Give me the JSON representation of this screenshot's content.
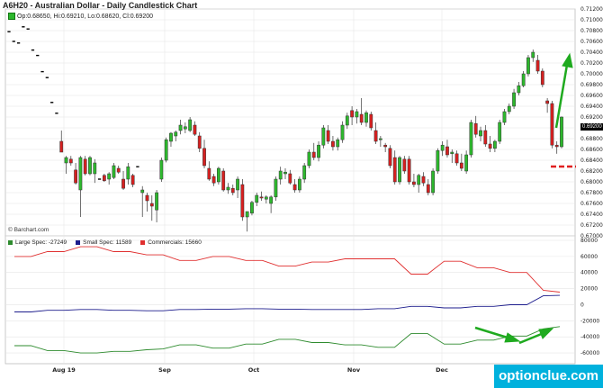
{
  "header": {
    "title": "A6H20 - Australian Dollar - Daily Candlestick Chart",
    "ohlc": "Op:0.68650, Hi:0.69210, Lo:0.68620, Cl:0.69200"
  },
  "credit": "© Barchart.com",
  "watermark": "optionclue.com",
  "last_price_label": "0.69200",
  "colors": {
    "up": "#2db82d",
    "down": "#d62020",
    "large_spec": "#2e8b2e",
    "small_spec": "#1c1c8c",
    "commercials": "#e03030",
    "arrow": "#1faa1f"
  },
  "chart_data": [
    {
      "type": "candlestick",
      "ylim": [
        0.67,
        0.712
      ],
      "yticks": [
        "0.71200",
        "0.71000",
        "0.70800",
        "0.70600",
        "0.70400",
        "0.70200",
        "0.70000",
        "0.69800",
        "0.69600",
        "0.69400",
        "0.69200",
        "0.69000",
        "0.68800",
        "0.68600",
        "0.68400",
        "0.68200",
        "0.68000",
        "0.67800",
        "0.67600",
        "0.67400",
        "0.67200",
        "0.67000"
      ],
      "xticks": [
        "Aug 19",
        "Sep",
        "Oct",
        "Nov",
        "Dec"
      ],
      "last_price": 0.692,
      "candles": [
        [
          0.7075,
          0.708,
          0.7072,
          0.7078
        ],
        [
          0.7062,
          0.7065,
          0.7058,
          0.706
        ],
        [
          0.7058,
          0.706,
          0.7055,
          0.7057
        ],
        [
          0.7086,
          0.7089,
          0.7084,
          0.7087
        ],
        [
          0.7082,
          0.7085,
          0.708,
          0.7083
        ],
        [
          0.7045,
          0.7048,
          0.7042,
          0.7044
        ],
        [
          0.7035,
          0.7038,
          0.7032,
          0.7034
        ],
        [
          0.7005,
          0.7008,
          0.7002,
          0.7004
        ],
        [
          0.6992,
          0.6995,
          0.699,
          0.6993
        ],
        [
          0.6948,
          0.695,
          0.6945,
          0.6947
        ],
        [
          0.6928,
          0.693,
          0.6926,
          0.6927
        ],
        [
          0.6875,
          0.6895,
          0.6855,
          0.6855
        ],
        [
          0.6835,
          0.6848,
          0.6815,
          0.6845
        ],
        [
          0.6842,
          0.6848,
          0.683,
          0.6835
        ],
        [
          0.6822,
          0.6835,
          0.6795,
          0.6798
        ],
        [
          0.6785,
          0.6848,
          0.6735,
          0.6845
        ],
        [
          0.6842,
          0.6848,
          0.6812,
          0.6815
        ],
        [
          0.6815,
          0.6848,
          0.6812,
          0.6845
        ],
        [
          0.6815,
          0.6842,
          0.6798,
          0.6835
        ],
        [
          0.6802,
          0.6808,
          0.68,
          0.6805
        ],
        [
          0.6812,
          0.6815,
          0.68,
          0.6802
        ],
        [
          0.6805,
          0.6818,
          0.6795,
          0.6815
        ],
        [
          0.6808,
          0.6835,
          0.6805,
          0.683
        ],
        [
          0.6825,
          0.683,
          0.6815,
          0.6818
        ],
        [
          0.6805,
          0.682,
          0.6785,
          0.6788
        ],
        [
          0.6805,
          0.6835,
          0.6795,
          0.6828
        ],
        [
          0.6812,
          0.6815,
          0.679,
          0.6795
        ],
        [
          0.683,
          0.6832,
          0.6825,
          0.6828
        ],
        [
          0.678,
          0.6792,
          0.6735,
          0.6785
        ],
        [
          0.6775,
          0.678,
          0.6745,
          0.6765
        ],
        [
          0.676,
          0.6775,
          0.6728,
          0.6755
        ],
        [
          0.6748,
          0.6785,
          0.6725,
          0.678
        ],
        [
          0.6805,
          0.6845,
          0.68,
          0.684
        ],
        [
          0.684,
          0.6882,
          0.6836,
          0.6878
        ],
        [
          0.6875,
          0.6892,
          0.6865,
          0.689
        ],
        [
          0.6885,
          0.6895,
          0.6875,
          0.6892
        ],
        [
          0.6895,
          0.6915,
          0.6888,
          0.6905
        ],
        [
          0.6898,
          0.691,
          0.689,
          0.6902
        ],
        [
          0.6895,
          0.692,
          0.6892,
          0.6915
        ],
        [
          0.6905,
          0.6912,
          0.6885,
          0.6888
        ],
        [
          0.6885,
          0.6892,
          0.6855,
          0.6862
        ],
        [
          0.6862,
          0.6878,
          0.6825,
          0.683
        ],
        [
          0.6825,
          0.6838,
          0.6802,
          0.6805
        ],
        [
          0.681,
          0.6815,
          0.6792,
          0.6798
        ],
        [
          0.68,
          0.6828,
          0.6795,
          0.6825
        ],
        [
          0.682,
          0.6825,
          0.6782,
          0.6785
        ],
        [
          0.6785,
          0.6798,
          0.6778,
          0.679
        ],
        [
          0.6788,
          0.6795,
          0.6775,
          0.678
        ],
        [
          0.6785,
          0.681,
          0.677,
          0.6805
        ],
        [
          0.6795,
          0.6805,
          0.6728,
          0.6735
        ],
        [
          0.6735,
          0.6745,
          0.6708,
          0.6745
        ],
        [
          0.6742,
          0.6765,
          0.6738,
          0.6762
        ],
        [
          0.6762,
          0.678,
          0.6755,
          0.6775
        ],
        [
          0.6772,
          0.6782,
          0.6765,
          0.677
        ],
        [
          0.6768,
          0.6775,
          0.676,
          0.6772
        ],
        [
          0.676,
          0.6775,
          0.6742,
          0.6772
        ],
        [
          0.6772,
          0.681,
          0.6765,
          0.6805
        ],
        [
          0.6805,
          0.6828,
          0.6795,
          0.682
        ],
        [
          0.6815,
          0.6825,
          0.6805,
          0.6818
        ],
        [
          0.6815,
          0.6822,
          0.6795,
          0.6798
        ],
        [
          0.6795,
          0.6805,
          0.678,
          0.6785
        ],
        [
          0.6785,
          0.681,
          0.678,
          0.6805
        ],
        [
          0.6805,
          0.6835,
          0.6798,
          0.683
        ],
        [
          0.683,
          0.686,
          0.6825,
          0.6855
        ],
        [
          0.6855,
          0.6872,
          0.684,
          0.6845
        ],
        [
          0.6845,
          0.6875,
          0.6838,
          0.6868
        ],
        [
          0.6868,
          0.6905,
          0.6862,
          0.69
        ],
        [
          0.6895,
          0.6905,
          0.687,
          0.6875
        ],
        [
          0.6875,
          0.6885,
          0.6858,
          0.6865
        ],
        [
          0.6865,
          0.6882,
          0.6858,
          0.6878
        ],
        [
          0.6878,
          0.6912,
          0.6872,
          0.6905
        ],
        [
          0.6905,
          0.6928,
          0.6898,
          0.6922
        ],
        [
          0.6932,
          0.694,
          0.6905,
          0.692
        ],
        [
          0.692,
          0.6935,
          0.6908,
          0.693
        ],
        [
          0.6925,
          0.6955,
          0.6905,
          0.691
        ],
        [
          0.691,
          0.6932,
          0.6902,
          0.6928
        ],
        [
          0.6925,
          0.693,
          0.6895,
          0.69
        ],
        [
          0.6895,
          0.691,
          0.687,
          0.6875
        ],
        [
          0.6878,
          0.6885,
          0.6865,
          0.688
        ],
        [
          0.6868,
          0.6872,
          0.6855,
          0.6865
        ],
        [
          0.6862,
          0.6868,
          0.6825,
          0.683
        ],
        [
          0.6845,
          0.6858,
          0.6795,
          0.68
        ],
        [
          0.68,
          0.6848,
          0.6795,
          0.6845
        ],
        [
          0.6842,
          0.6848,
          0.6815,
          0.682
        ],
        [
          0.6842,
          0.6848,
          0.6795,
          0.68
        ],
        [
          0.68,
          0.6815,
          0.679,
          0.6795
        ],
        [
          0.6795,
          0.6815,
          0.678,
          0.6812
        ],
        [
          0.681,
          0.6818,
          0.6792,
          0.6798
        ],
        [
          0.6795,
          0.6805,
          0.6775,
          0.678
        ],
        [
          0.678,
          0.6825,
          0.6775,
          0.682
        ],
        [
          0.682,
          0.6862,
          0.6815,
          0.6858
        ],
        [
          0.6858,
          0.6875,
          0.6848,
          0.6868
        ],
        [
          0.6865,
          0.6878,
          0.6845,
          0.685
        ],
        [
          0.6852,
          0.686,
          0.6835,
          0.6855
        ],
        [
          0.6852,
          0.6858,
          0.683,
          0.6835
        ],
        [
          0.6835,
          0.6852,
          0.682,
          0.6825
        ],
        [
          0.682,
          0.6858,
          0.6815,
          0.685
        ],
        [
          0.685,
          0.6915,
          0.6845,
          0.691
        ],
        [
          0.6908,
          0.6922,
          0.6882,
          0.6888
        ],
        [
          0.6885,
          0.6902,
          0.6875,
          0.6895
        ],
        [
          0.6895,
          0.6905,
          0.6865,
          0.687
        ],
        [
          0.687,
          0.6885,
          0.6855,
          0.6862
        ],
        [
          0.6862,
          0.6878,
          0.6855,
          0.6875
        ],
        [
          0.6875,
          0.6915,
          0.687,
          0.691
        ],
        [
          0.691,
          0.6935,
          0.6905,
          0.693
        ],
        [
          0.693,
          0.6945,
          0.6925,
          0.694
        ],
        [
          0.694,
          0.6972,
          0.6935,
          0.6965
        ],
        [
          0.6965,
          0.6985,
          0.696,
          0.6978
        ],
        [
          0.6978,
          0.7005,
          0.6975,
          0.7
        ],
        [
          0.7,
          0.7035,
          0.6995,
          0.703
        ],
        [
          0.703,
          0.7045,
          0.7022,
          0.704
        ],
        [
          0.7025,
          0.7035,
          0.7,
          0.7005
        ],
        [
          0.7005,
          0.701,
          0.6975,
          0.698
        ],
        [
          0.695,
          0.6955,
          0.6928,
          0.6945
        ],
        [
          0.6945,
          0.695,
          0.6862,
          0.6868
        ],
        [
          0.6868,
          0.6875,
          0.6852,
          0.6865
        ],
        [
          0.6865,
          0.6921,
          0.6862,
          0.692
        ]
      ]
    },
    {
      "type": "line",
      "ylim": [
        -70000,
        80000
      ],
      "yticks": [
        "80000",
        "60000",
        "40000",
        "20000",
        "0",
        "-20000",
        "-40000",
        "-60000"
      ],
      "legend": [
        {
          "name": "Large Spec: -27249",
          "color": "#2e8b2e"
        },
        {
          "name": "Small Spec: 11589",
          "color": "#1c1c8c"
        },
        {
          "name": "Commercials: 15660",
          "color": "#e03030"
        }
      ],
      "series": [
        {
          "name": "Large Spec",
          "values": [
            -51000,
            -51000,
            -57000,
            -57000,
            -60000,
            -60000,
            -58000,
            -58000,
            -56000,
            -55000,
            -50000,
            -50000,
            -54000,
            -54000,
            -49000,
            -49000,
            -43000,
            -43000,
            -47000,
            -47000,
            -50000,
            -50000,
            -53000,
            -53000,
            -36000,
            -36000,
            -49000,
            -49000,
            -44000,
            -44000,
            -39000,
            -39000,
            -30000,
            -27249
          ]
        },
        {
          "name": "Small Spec",
          "values": [
            -9000,
            -9000,
            -7000,
            -7000,
            -6000,
            -6000,
            -7000,
            -7000,
            -7500,
            -7500,
            -6000,
            -6000,
            -5500,
            -5500,
            -5000,
            -5000,
            -5500,
            -5500,
            -6000,
            -6000,
            -6000,
            -6000,
            -5000,
            -5000,
            -2000,
            -2000,
            -4000,
            -4000,
            -2000,
            -2000,
            0,
            0,
            11000,
            11589
          ]
        },
        {
          "name": "Commercials",
          "values": [
            60000,
            60000,
            66000,
            66000,
            72000,
            72000,
            66000,
            66000,
            62000,
            62000,
            55000,
            55000,
            60000,
            60000,
            55000,
            55000,
            48000,
            48000,
            53000,
            53000,
            57000,
            57000,
            57000,
            57000,
            38000,
            38000,
            54000,
            54000,
            46000,
            46000,
            40000,
            40000,
            18000,
            15660
          ]
        }
      ]
    }
  ]
}
